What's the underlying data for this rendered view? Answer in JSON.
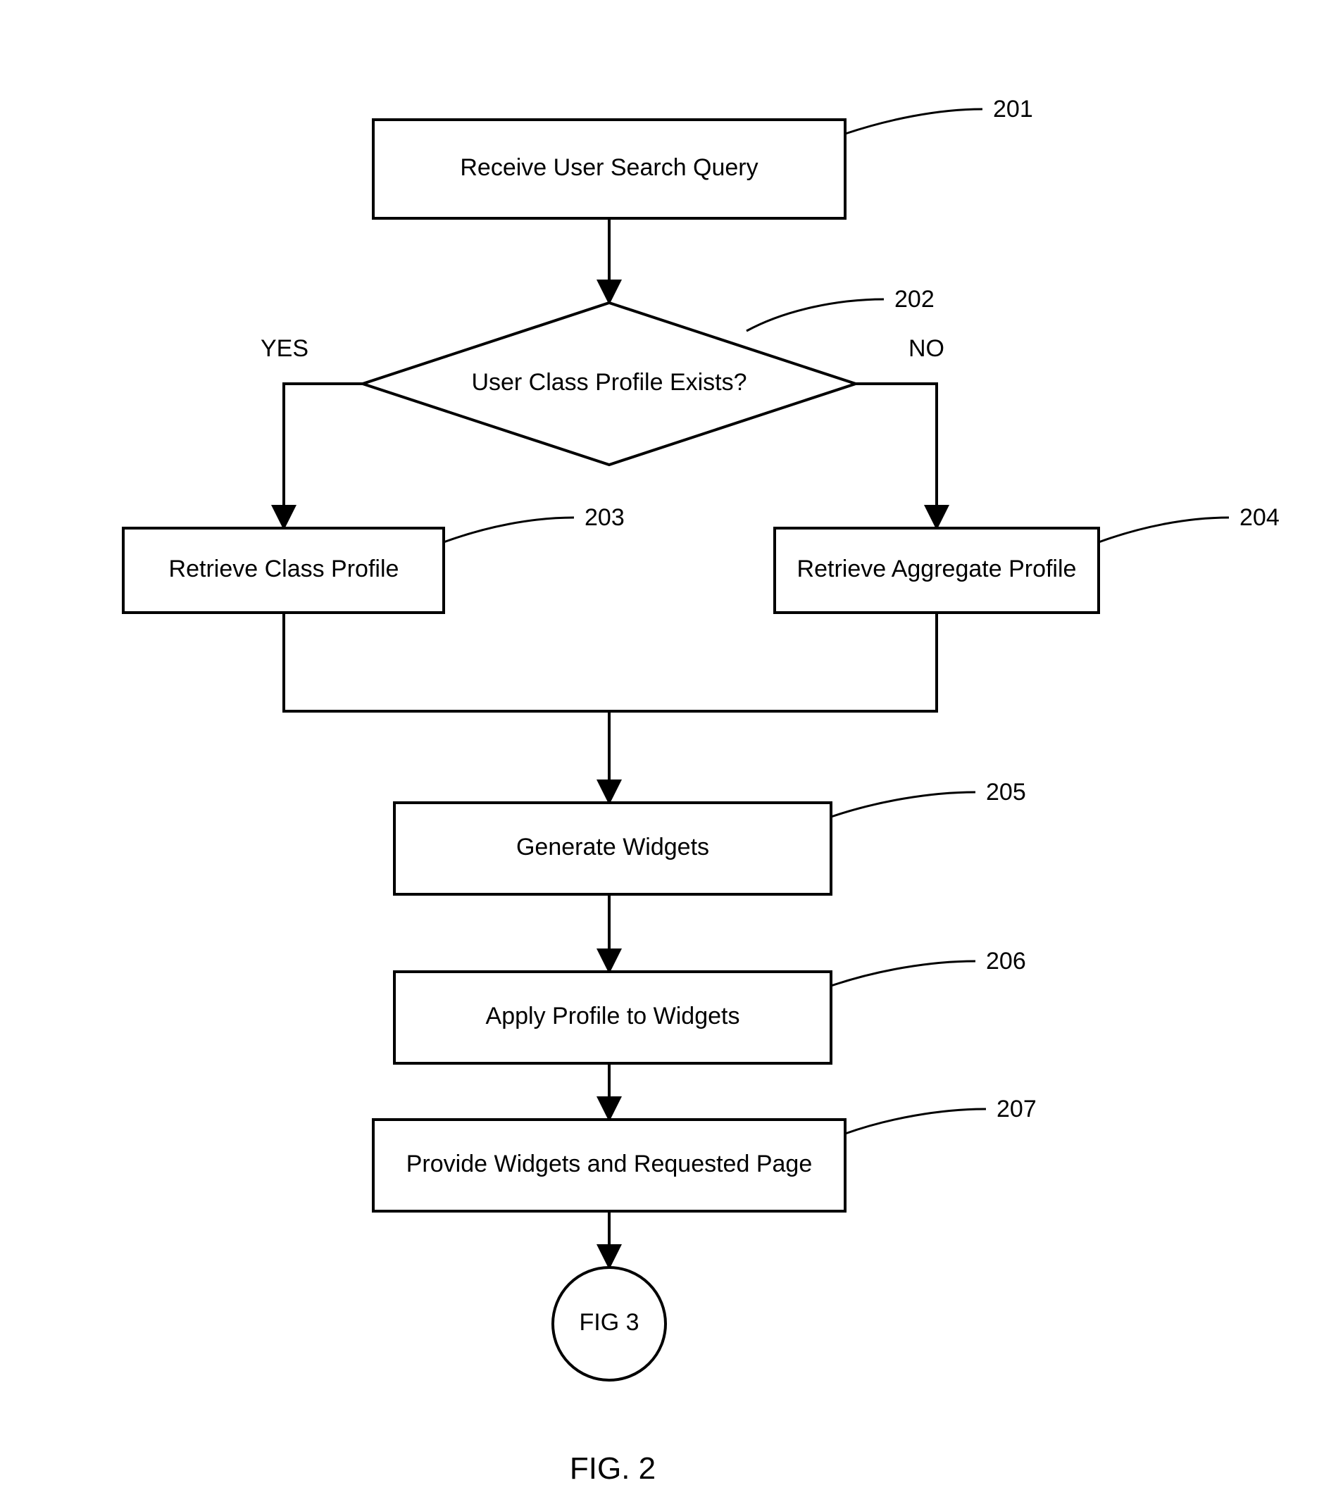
{
  "nodes": {
    "n201": {
      "label": "Receive User Search Query",
      "ref": "201"
    },
    "n202": {
      "label": "User Class Profile Exists?",
      "ref": "202"
    },
    "n203": {
      "label": "Retrieve Class Profile",
      "ref": "203"
    },
    "n204": {
      "label": "Retrieve Aggregate Profile",
      "ref": "204"
    },
    "n205": {
      "label": "Generate Widgets",
      "ref": "205"
    },
    "n206": {
      "label": "Apply Profile to Widgets",
      "ref": "206"
    },
    "n207": {
      "label": "Provide Widgets and Requested Page",
      "ref": "207"
    },
    "term": {
      "label": "FIG 3"
    }
  },
  "branches": {
    "yes": "YES",
    "no": "NO"
  },
  "caption": "FIG. 2"
}
